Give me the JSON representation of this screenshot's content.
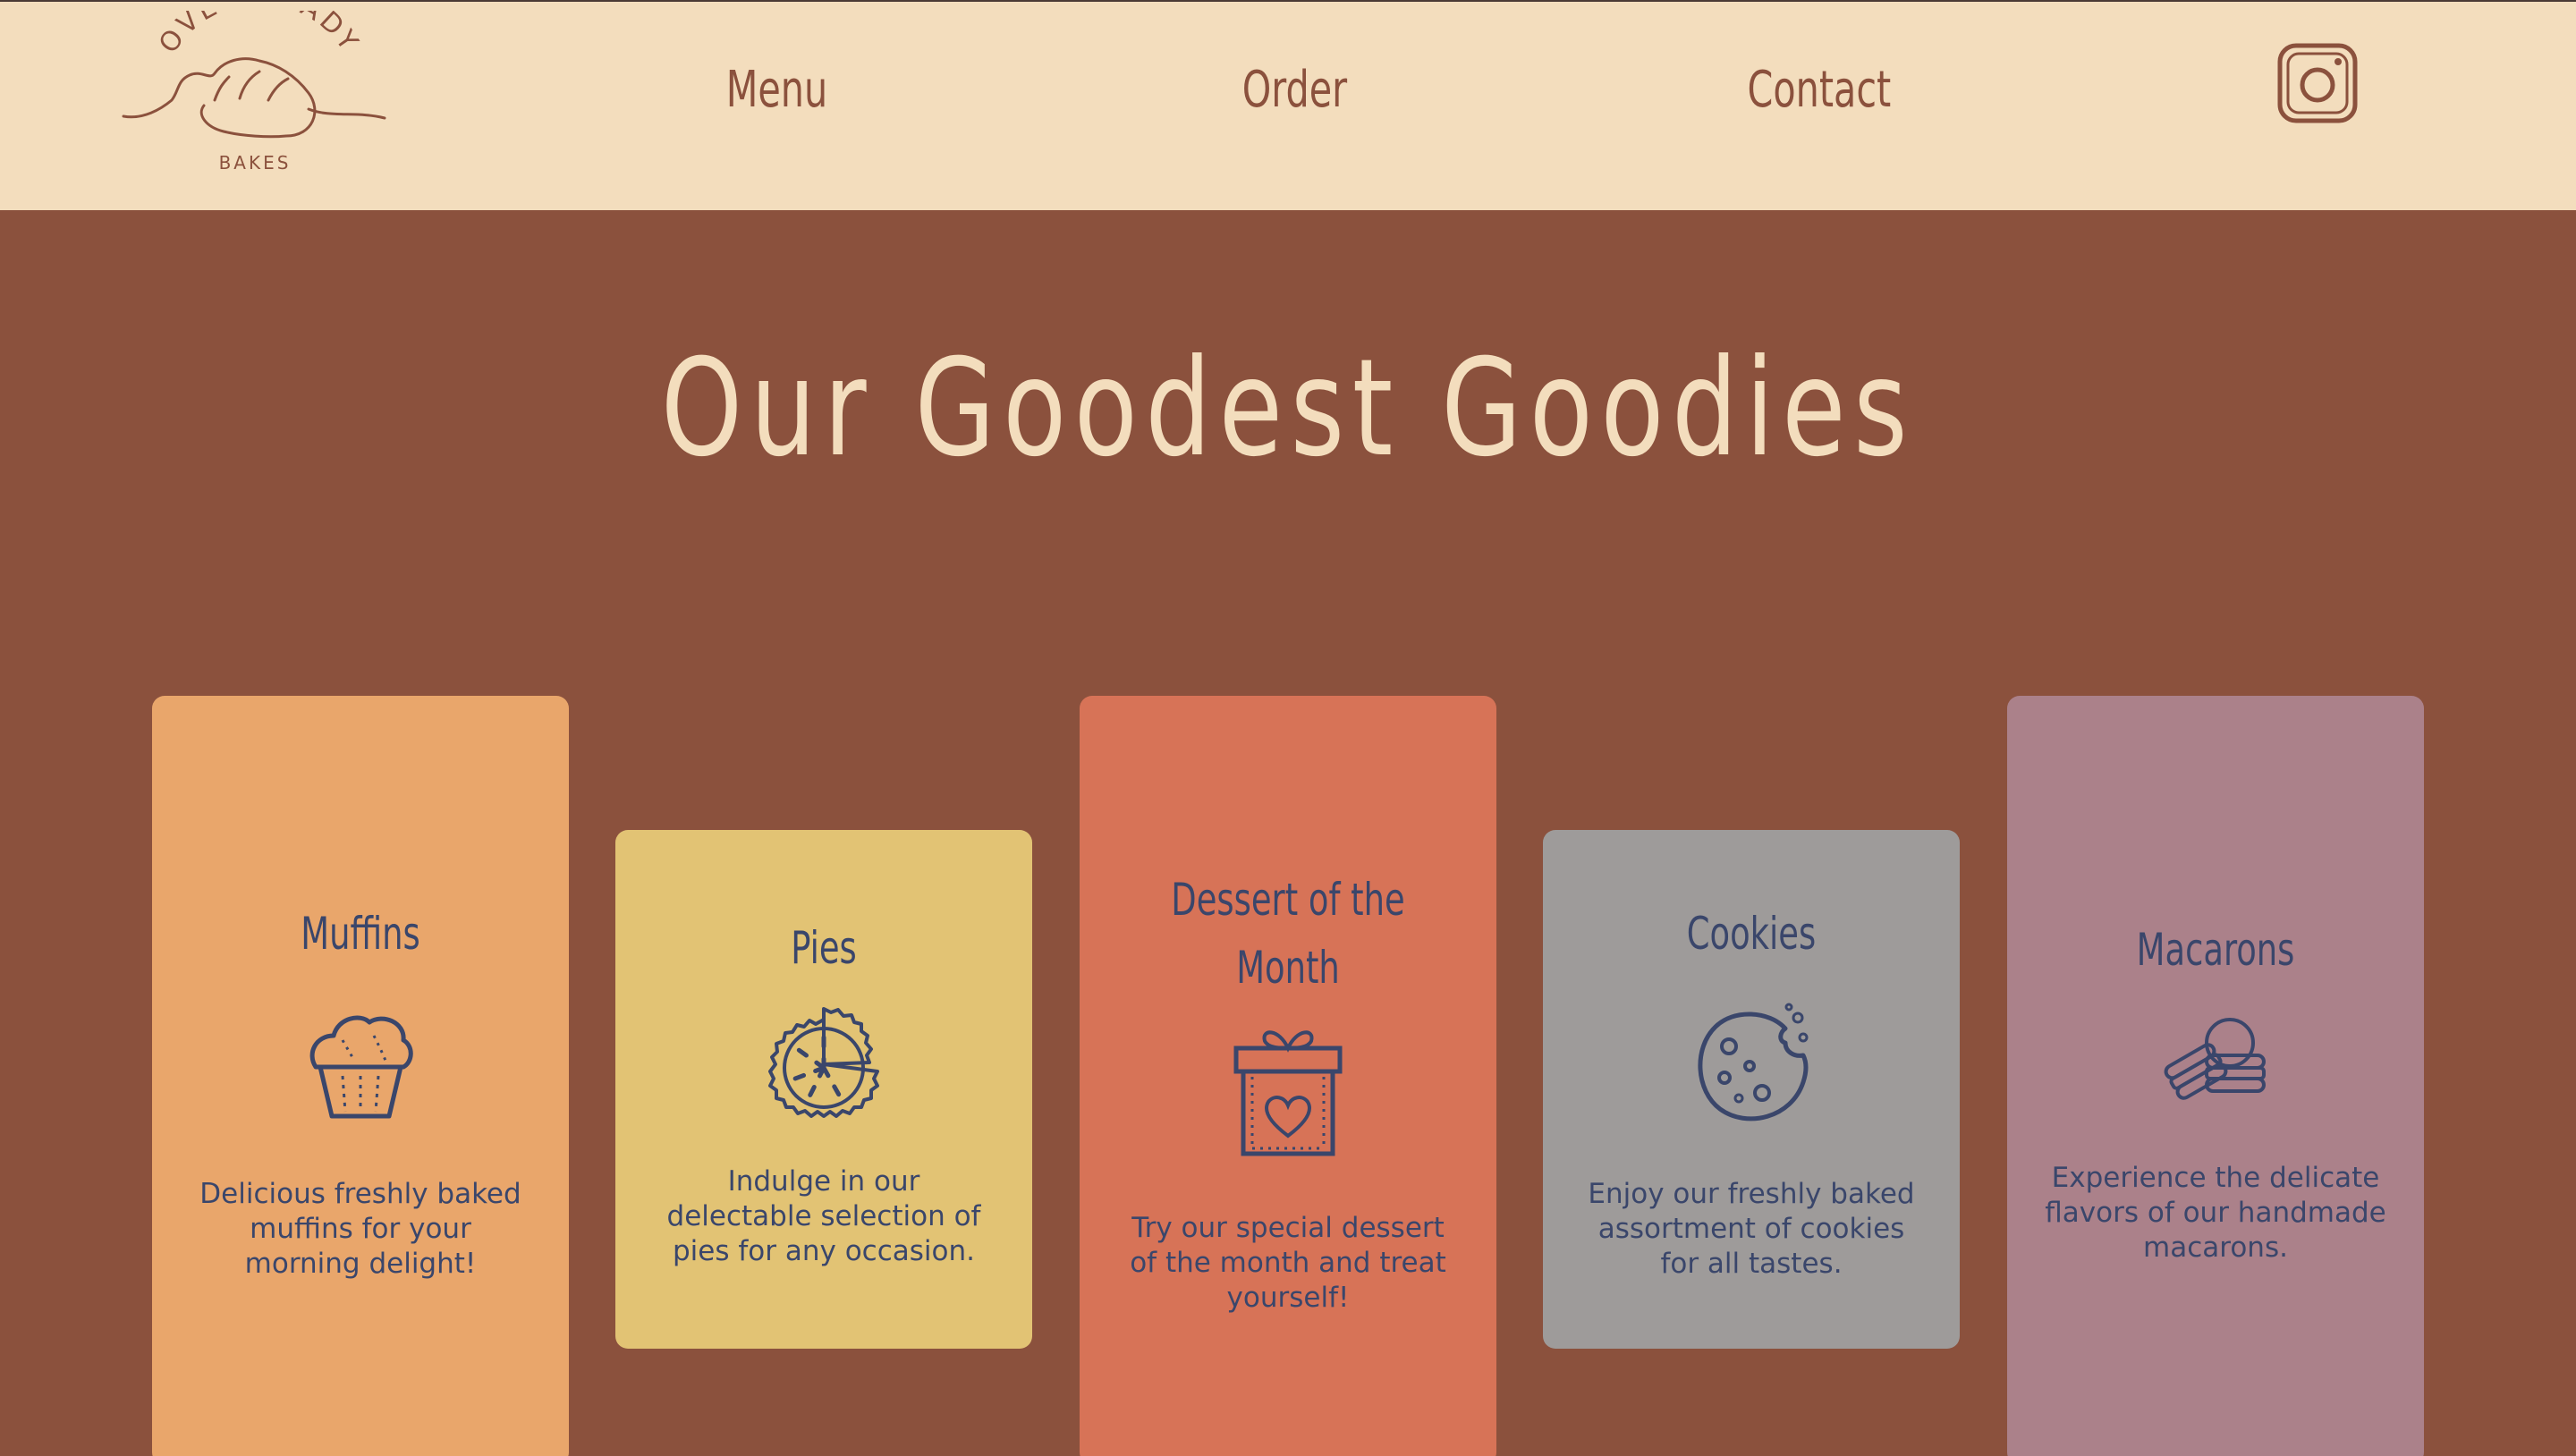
{
  "header": {
    "logo": {
      "arc_text": "OVEN READY",
      "sub_text": "BAKES",
      "icon": "bread-loaf-logo-icon"
    },
    "nav": [
      {
        "label": "Menu"
      },
      {
        "label": "Order"
      },
      {
        "label": "Contact"
      }
    ],
    "social_icon": "instagram-icon"
  },
  "hero": {
    "title": "Our Goodest Goodies"
  },
  "cards": [
    {
      "title": "Muffins",
      "icon": "muffin-icon",
      "description": "Delicious freshly baked muffins for your morning delight!",
      "color": "#e9a66b"
    },
    {
      "title": "Pies",
      "icon": "pie-icon",
      "description": "Indulge in our delectable selection of pies for any occasion.",
      "color": "#e2c374"
    },
    {
      "title": "Dessert of the Month",
      "icon": "gift-box-icon",
      "description": "Try our special dessert of the month and treat yourself!",
      "color": "#d77357"
    },
    {
      "title": "Cookies",
      "icon": "cookie-icon",
      "description": "Enjoy our freshly baked assortment of cookies for all tastes.",
      "color": "#9e9b9a"
    },
    {
      "title": "Macarons",
      "icon": "macarons-icon",
      "description": "Experience the delicate flavors of our handmade macarons.",
      "color": "#ab818a"
    }
  ],
  "colors": {
    "background": "#8b513d",
    "header": "#f3ddbd",
    "accent_text": "#3a466b"
  }
}
